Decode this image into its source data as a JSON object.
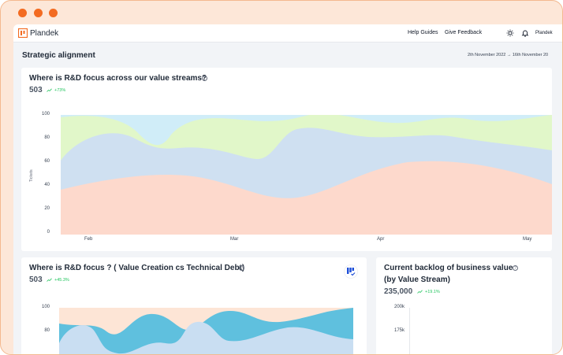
{
  "window": {
    "controls": [
      "close",
      "minimize",
      "maximize"
    ]
  },
  "header": {
    "brand": "Plandek",
    "help_guides": "Help Guides",
    "give_feedback": "Give Feedback",
    "user": "Plandek",
    "icons": [
      "sun-icon",
      "bell-icon"
    ]
  },
  "page": {
    "title": "Strategic alignment",
    "date_range": "2th November 2022  →  16th November 20"
  },
  "card1": {
    "title": "Where is R&D focus across our value streams?",
    "kpi": "503",
    "trend": "+73%",
    "y_axis_title": "Tickets",
    "y_ticks": [
      "100",
      "80",
      "60",
      "40",
      "20",
      "0"
    ],
    "x_ticks": [
      "Feb",
      "Mar",
      "Apr",
      "May"
    ]
  },
  "card2": {
    "title": "Where is R&D focus ? ( Value Creation cs Technical Debt)",
    "kpi": "503",
    "trend": "+45.3%",
    "y_ticks": [
      "100",
      "80"
    ]
  },
  "card3": {
    "title_line1": "Current backlog of business value",
    "title_line2": "(by Value Stream)",
    "kpi": "235,000",
    "trend": "+19.1%",
    "y_ticks": [
      "200k",
      "175k"
    ]
  },
  "colors": {
    "accent": "#f36b21",
    "stream_a": "#fdd9cc",
    "stream_b": "#cfe0f1",
    "stream_c": "#e1f7c9",
    "stream_d": "#d0edf8",
    "value_creation": "#5fc0de",
    "tech_debt": "#c9def2",
    "trend_positive": "#22c55e"
  },
  "chart_data": [
    {
      "type": "area",
      "stacked": true,
      "x": [
        "Feb",
        "Mar",
        "Apr",
        "May"
      ],
      "ylabel": "Tickets",
      "ylim": [
        0,
        100
      ],
      "series": [
        {
          "values": [
            45,
            35,
            62,
            45
          ]
        },
        {
          "values": [
            38,
            35,
            20,
            32
          ]
        },
        {
          "values": [
            12,
            25,
            15,
            23
          ]
        },
        {
          "values": [
            5,
            5,
            3,
            0
          ]
        }
      ]
    },
    {
      "type": "area",
      "ylim": [
        70,
        100
      ],
      "series": [
        {
          "values": [
            82,
            78,
            86,
            80
          ]
        },
        {
          "values": [
            96,
            92,
            98,
            100
          ]
        }
      ]
    }
  ]
}
